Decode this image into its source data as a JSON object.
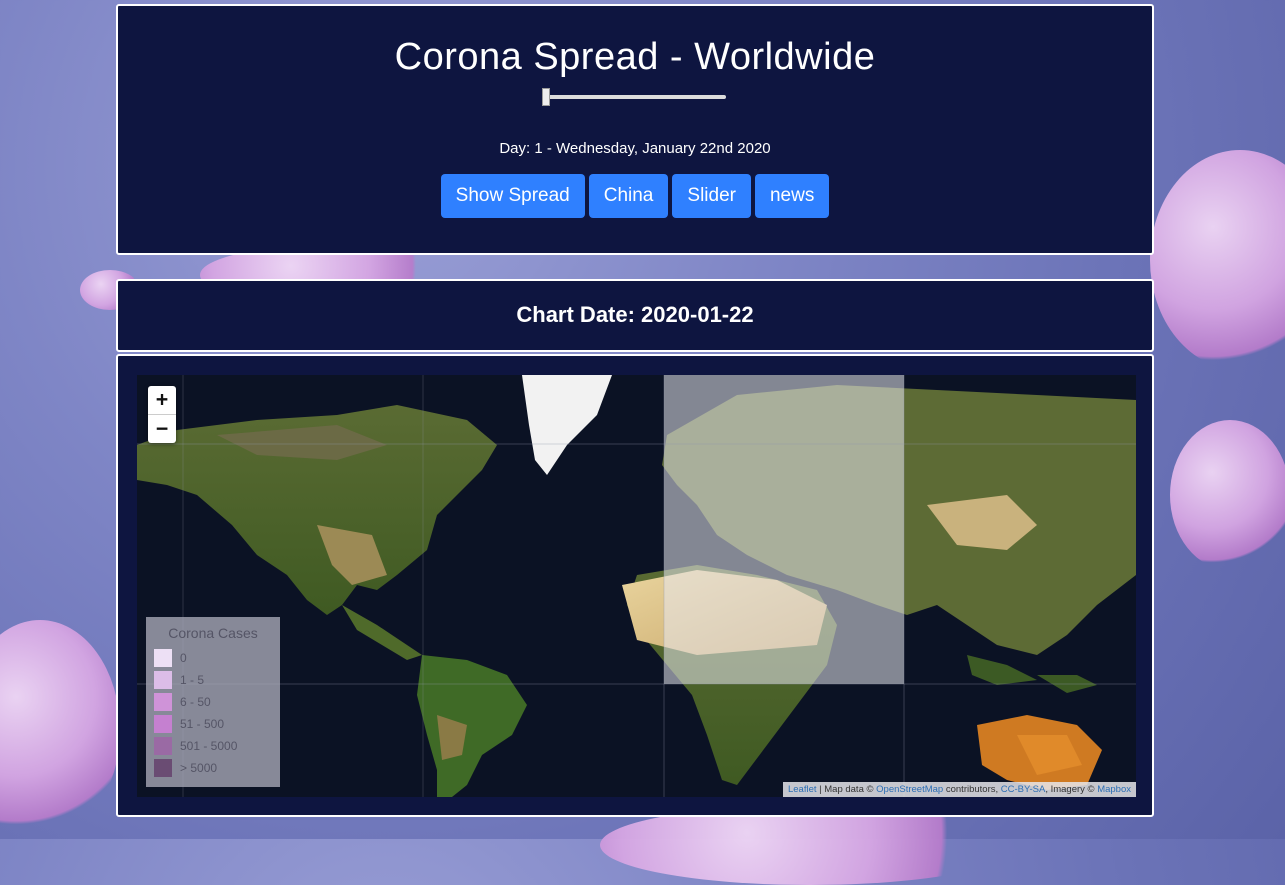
{
  "header": {
    "title": "Corona Spread - Worldwide",
    "day_text": "Day: 1 - Wednesday, January 22nd 2020",
    "slider_value": 0,
    "buttons": [
      "Show Spread",
      "China",
      "Slider",
      "news"
    ]
  },
  "chart_date": {
    "label": "Chart Date: 2020-01-22"
  },
  "map": {
    "zoom_in": "+",
    "zoom_out": "−",
    "legend": {
      "title": "Corona Cases",
      "items": [
        {
          "label": "0",
          "color": "#ede0f5"
        },
        {
          "label": "1 - 5",
          "color": "#dcbde8"
        },
        {
          "label": "6 - 50",
          "color": "#cf93d8"
        },
        {
          "label": "51 - 500",
          "color": "#c580d0"
        },
        {
          "label": "501 - 5000",
          "color": "#9a6aa4"
        },
        {
          "label": "> 5000",
          "color": "#6a4c73"
        }
      ]
    },
    "attribution": {
      "leaflet": "Leaflet",
      "map_data": " | Map data © ",
      "osm": "OpenStreetMap",
      "contributors": " contributors, ",
      "license": "CC-BY-SA",
      "imagery": ", Imagery © ",
      "provider": "Mapbox"
    }
  },
  "colors": {
    "panel_bg": "#0e1540",
    "button": "#2f80ff",
    "highlight_overlay": "#e8e8ee"
  }
}
